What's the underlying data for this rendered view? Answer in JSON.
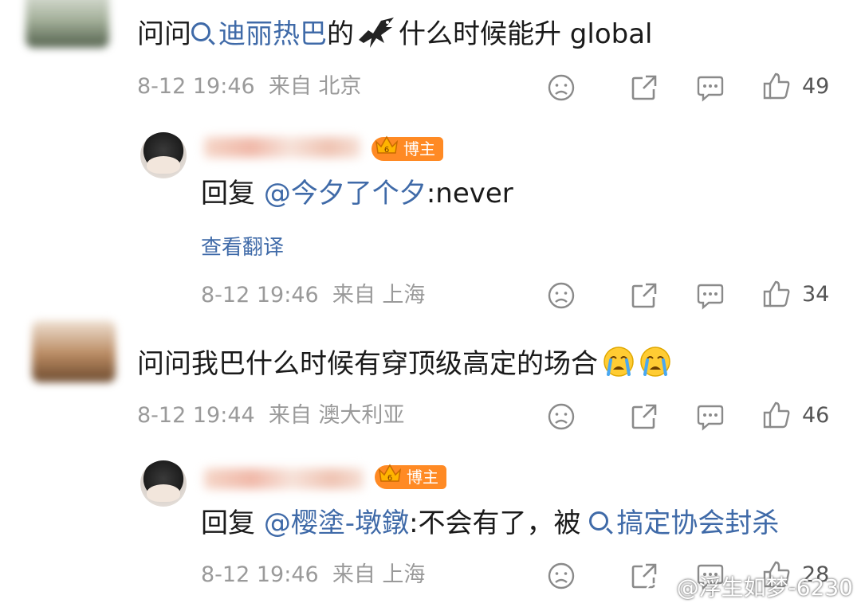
{
  "comments": [
    {
      "text_prefix": "问问",
      "topic": "迪丽热巴",
      "text_mid": "的",
      "text_suffix": "什么时候能升 global",
      "time": "8-12 19:46",
      "location": "来自 北京",
      "likes": "49"
    },
    {
      "reply_badge": "博主",
      "reply_prefix": "回复",
      "mention": "@今夕了个夕",
      "reply_suffix": ":never",
      "translate": "查看翻译",
      "time": "8-12 19:46",
      "location": "来自 上海",
      "likes": "34"
    },
    {
      "text": "问问我巴什么时候有穿顶级高定的场合",
      "time": "8-12 19:44",
      "location": "来自 澳大利亚",
      "likes": "46"
    },
    {
      "reply_badge": "博主",
      "reply_prefix": "回复",
      "mention": "@樱塗-墩鐓",
      "reply_mid": ":不会有了，被",
      "topic": "搞定协会封杀",
      "time": "8-12 19:46",
      "location": "来自 上海",
      "likes": "28"
    }
  ],
  "watermark": "@浮生如梦-6230",
  "colors": {
    "link": "#3f6aa8",
    "meta": "#9a9a9a",
    "badge": "#ff8a24"
  },
  "icons": [
    "dislike-icon",
    "share-icon",
    "comment-icon",
    "like-icon",
    "eagle-emoji",
    "crying-emoji",
    "crown-icon",
    "topic-search-icon"
  ]
}
